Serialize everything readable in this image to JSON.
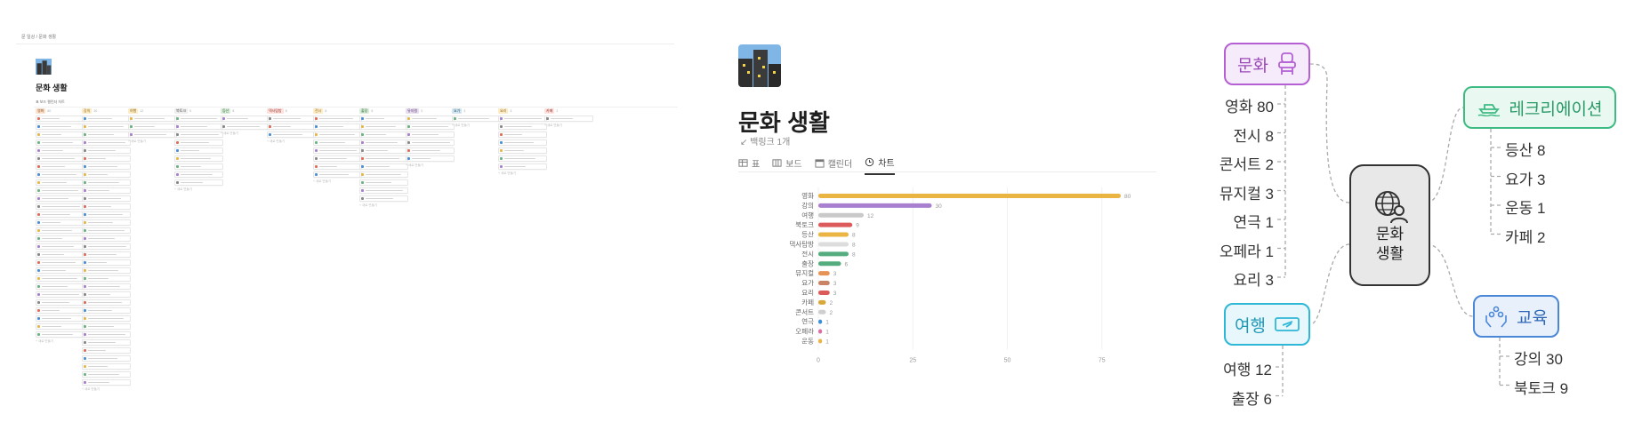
{
  "board": {
    "breadcrumb": "문 일상 / 문화 생활",
    "title": "문화 생활",
    "subtitle": "",
    "tabs_text": "표   보드   캘린더   차트",
    "new_label": "+ 새로 만들기",
    "columns": [
      {
        "label": "영화",
        "count": "80",
        "tag_bg": "#fbe3cf",
        "tag_fg": "#8a4a1f",
        "cards": 28
      },
      {
        "label": "강의",
        "count": "30",
        "tag_bg": "#fdecc8",
        "tag_fg": "#8a6a1f",
        "cards": 34
      },
      {
        "label": "여행",
        "count": "12",
        "tag_bg": "#fdecc8",
        "tag_fg": "#8a6a1f",
        "cards": 3
      },
      {
        "label": "북토크",
        "count": "9",
        "tag_bg": "#eeeeee",
        "tag_fg": "#555555",
        "cards": 9
      },
      {
        "label": "등산",
        "count": "8",
        "tag_bg": "#dbeddb",
        "tag_fg": "#2b6a3a",
        "cards": 2
      },
      {
        "label": "댁사탐방",
        "count": "8",
        "tag_bg": "#ffe2dd",
        "tag_fg": "#8a2f2f",
        "cards": 3
      },
      {
        "label": "전시",
        "count": "8",
        "tag_bg": "#fdecc8",
        "tag_fg": "#8a6a1f",
        "cards": 8
      },
      {
        "label": "출장",
        "count": "6",
        "tag_bg": "#dbeddb",
        "tag_fg": "#2b6a3a",
        "cards": 11
      },
      {
        "label": "뮤지컬",
        "count": "3",
        "tag_bg": "#e8deee",
        "tag_fg": "#5a3a7a",
        "cards": 6
      },
      {
        "label": "요가",
        "count": "3",
        "tag_bg": "#d3e5ef",
        "tag_fg": "#2a5a7a",
        "cards": 1
      },
      {
        "label": "요리",
        "count": "3",
        "tag_bg": "#fdecc8",
        "tag_fg": "#8a6a1f",
        "cards": 7
      },
      {
        "label": "카페",
        "count": "2",
        "tag_bg": "#ffe2dd",
        "tag_fg": "#8a2f2f",
        "cards": 1
      }
    ]
  },
  "page": {
    "title": "문화 생활",
    "backlink": "↙ 백링크 1개",
    "tabs": [
      {
        "label": "표",
        "icon": "table-icon",
        "active": false
      },
      {
        "label": "보드",
        "icon": "board-icon",
        "active": false
      },
      {
        "label": "캘린더",
        "icon": "calendar-icon",
        "active": false
      },
      {
        "label": "차트",
        "icon": "clock-icon",
        "active": true
      }
    ]
  },
  "chart_data": {
    "type": "bar",
    "orientation": "horizontal",
    "categories": [
      "영화",
      "강의",
      "여행",
      "북토크",
      "등산",
      "댁사탐방",
      "전시",
      "출장",
      "뮤지컬",
      "요가",
      "요리",
      "카페",
      "콘서트",
      "연극",
      "오페라",
      "운동"
    ],
    "values": [
      80,
      30,
      12,
      9,
      8,
      8,
      8,
      6,
      3,
      3,
      3,
      2,
      2,
      1,
      1,
      1
    ],
    "colors": [
      "#eab543",
      "#a880cf",
      "#c9c9c9",
      "#dd5a5a",
      "#eab543",
      "#dddddd",
      "#55ad7f",
      "#55ad7f",
      "#e69355",
      "#c98464",
      "#dd5a5a",
      "#d8a83c",
      "#cfcfcf",
      "#3b8ed8",
      "#d96fa6",
      "#eab543"
    ],
    "xticks": [
      0,
      25,
      50,
      75
    ],
    "xlim": [
      0,
      80
    ],
    "grid": true,
    "legend": "none"
  },
  "mindmap": {
    "center": {
      "line1": "문화",
      "line2": "생활",
      "icon": "globe-person-icon"
    },
    "branches": [
      {
        "key": "culture",
        "label": "문화",
        "icon": "theater-seat-icon",
        "border": "#b460d3",
        "bg": "#f6ebfb",
        "fg": "#9a4ab8",
        "leaves": [
          "영화 80",
          "전시 8",
          "콘서트 2",
          "뮤지컬 3",
          "연극 1",
          "오페라 1",
          "요리 3"
        ]
      },
      {
        "key": "recreation",
        "label": "레크리에이션",
        "icon": "boat-icon",
        "border": "#3dbb82",
        "bg": "#e9f8f0",
        "fg": "#2a9a68",
        "leaves": [
          "등산 8",
          "요가 3",
          "운동 1",
          "카페 2"
        ]
      },
      {
        "key": "travel",
        "label": "여행",
        "icon": "ticket-icon",
        "border": "#2fb7d6",
        "bg": "#e7f7fb",
        "fg": "#1f97b6",
        "leaves": [
          "여행 12",
          "출장 6"
        ]
      },
      {
        "key": "education",
        "label": "교육",
        "icon": "hands-icon",
        "border": "#4a87d6",
        "bg": "#e8f0fb",
        "fg": "#2f67b6",
        "leaves": [
          "강의 30",
          "북토크 9"
        ]
      }
    ]
  }
}
